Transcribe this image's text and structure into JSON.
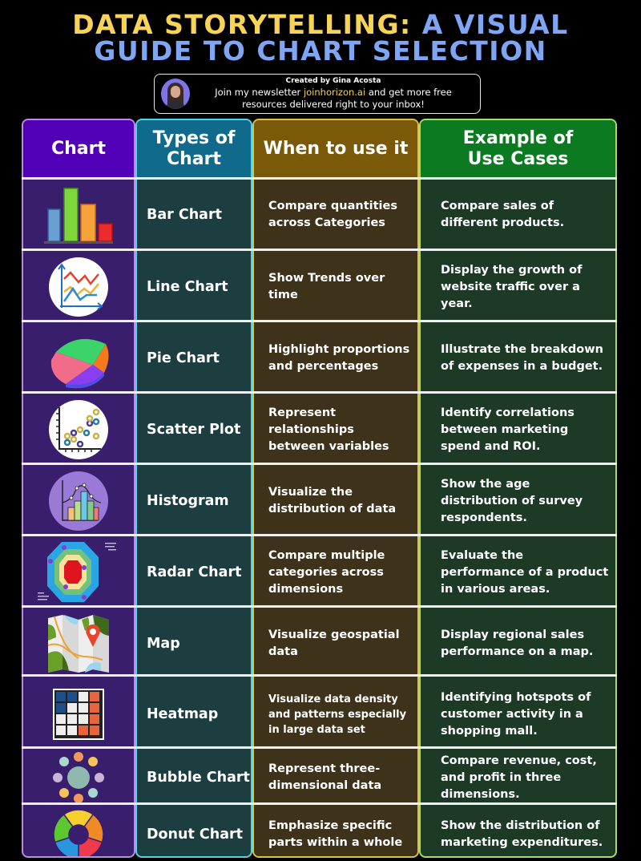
{
  "header": {
    "title_line1_part1": "DATA STORYTELLING:",
    "title_line1_part2": "A VISUAL",
    "title_line2": "GUIDE TO CHART SELECTION",
    "colors": {
      "title_yellow": "#f7d358",
      "title_blue": "#7fa6f5"
    }
  },
  "banner": {
    "credit": "Created by Gina Acosta",
    "message_prefix": "Join my newsletter",
    "link": "joinhorizon.ai",
    "message_suffix": "and get more free resources delivered right to your inbox!"
  },
  "table": {
    "headers": {
      "chart": "Chart",
      "types": "Types of Chart",
      "when": "When to use it",
      "examples": "Example of Use Cases"
    },
    "header_colors": {
      "chart": "#5200b8",
      "types": "#0f6a8c",
      "when": "#7a5a08",
      "examples": "#0c7a20"
    },
    "rows": [
      {
        "icon": "bar-chart-icon",
        "type": "Bar Chart",
        "when": "Compare quantities across Categories",
        "example": "Compare sales of different products."
      },
      {
        "icon": "line-chart-icon",
        "type": "Line Chart",
        "when": "Show Trends over time",
        "example": "Display the growth of website traffic over a year."
      },
      {
        "icon": "pie-chart-icon",
        "type": "Pie Chart",
        "when": "Highlight proportions and percentages",
        "example": "Illustrate the breakdown of expenses in a budget."
      },
      {
        "icon": "scatter-plot-icon",
        "type": "Scatter Plot",
        "when": "Represent relationships between variables",
        "example": "Identify correlations between marketing spend and ROI."
      },
      {
        "icon": "histogram-icon",
        "type": "Histogram",
        "when": "Visualize the distribution of data",
        "example": "Show the age distribution of survey respondents."
      },
      {
        "icon": "radar-chart-icon",
        "type": "Radar Chart",
        "when": "Compare multiple categories across dimensions",
        "example": "Evaluate the performance of a product in various areas."
      },
      {
        "icon": "map-icon",
        "type": "Map",
        "when": "Visualize geospatial data",
        "example": "Display regional sales performance on a map."
      },
      {
        "icon": "heatmap-icon",
        "type": "Heatmap",
        "when": "Visualize data density and patterns especially in large data set",
        "example": "Identifying hotspots of customer activity in a shopping mall."
      },
      {
        "icon": "bubble-chart-icon",
        "type": "Bubble Chart",
        "when": "Represent three-dimensional data",
        "example": "Compare revenue, cost, and profit in three dimensions."
      },
      {
        "icon": "donut-chart-icon",
        "type": "Donut Chart",
        "when": "Emphasize specific parts within a whole",
        "example": "Show the distribution of marketing expenditures."
      }
    ]
  }
}
